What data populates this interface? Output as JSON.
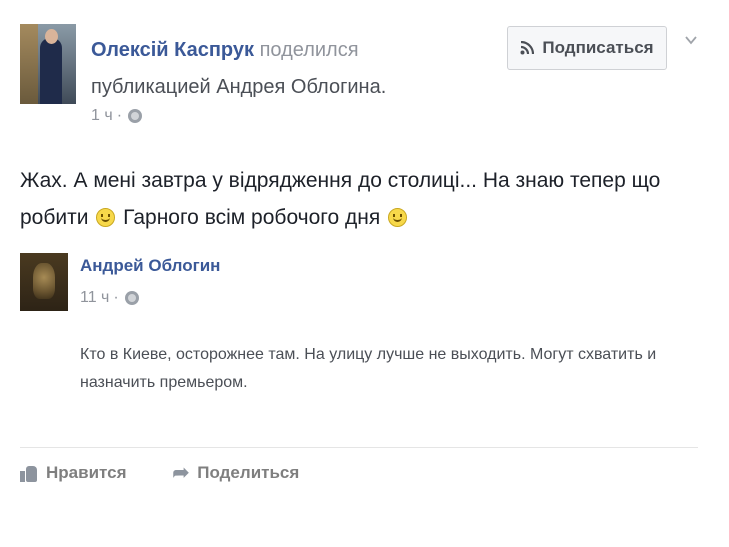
{
  "post": {
    "author": "Олексій Каспрук",
    "shared_verb": "поделился",
    "shared_object": "публикацией Андрея Облогина.",
    "time": "1 ч",
    "separator": "·",
    "subscribe_label": "Подписаться",
    "body_part1": "Жах. А мені завтра у відрядження до столиці... На знаю тепер що робити",
    "body_part2": "Гарного всім робочого дня"
  },
  "shared_post": {
    "author": "Андрей Облогин",
    "time": "11 ч",
    "separator": "·",
    "text": "Кто в Киеве, осторожнее там. На улицу лучше не выходить. Могут схватить и назначить премьером."
  },
  "actions": {
    "like_label": "Нравится",
    "share_label": "Поделиться"
  },
  "icons": {
    "globe": "globe-icon",
    "rss": "rss-icon",
    "smiley": "smiley-icon",
    "like": "like-icon",
    "share": "share-icon",
    "chevron": "chevron-down-icon"
  }
}
